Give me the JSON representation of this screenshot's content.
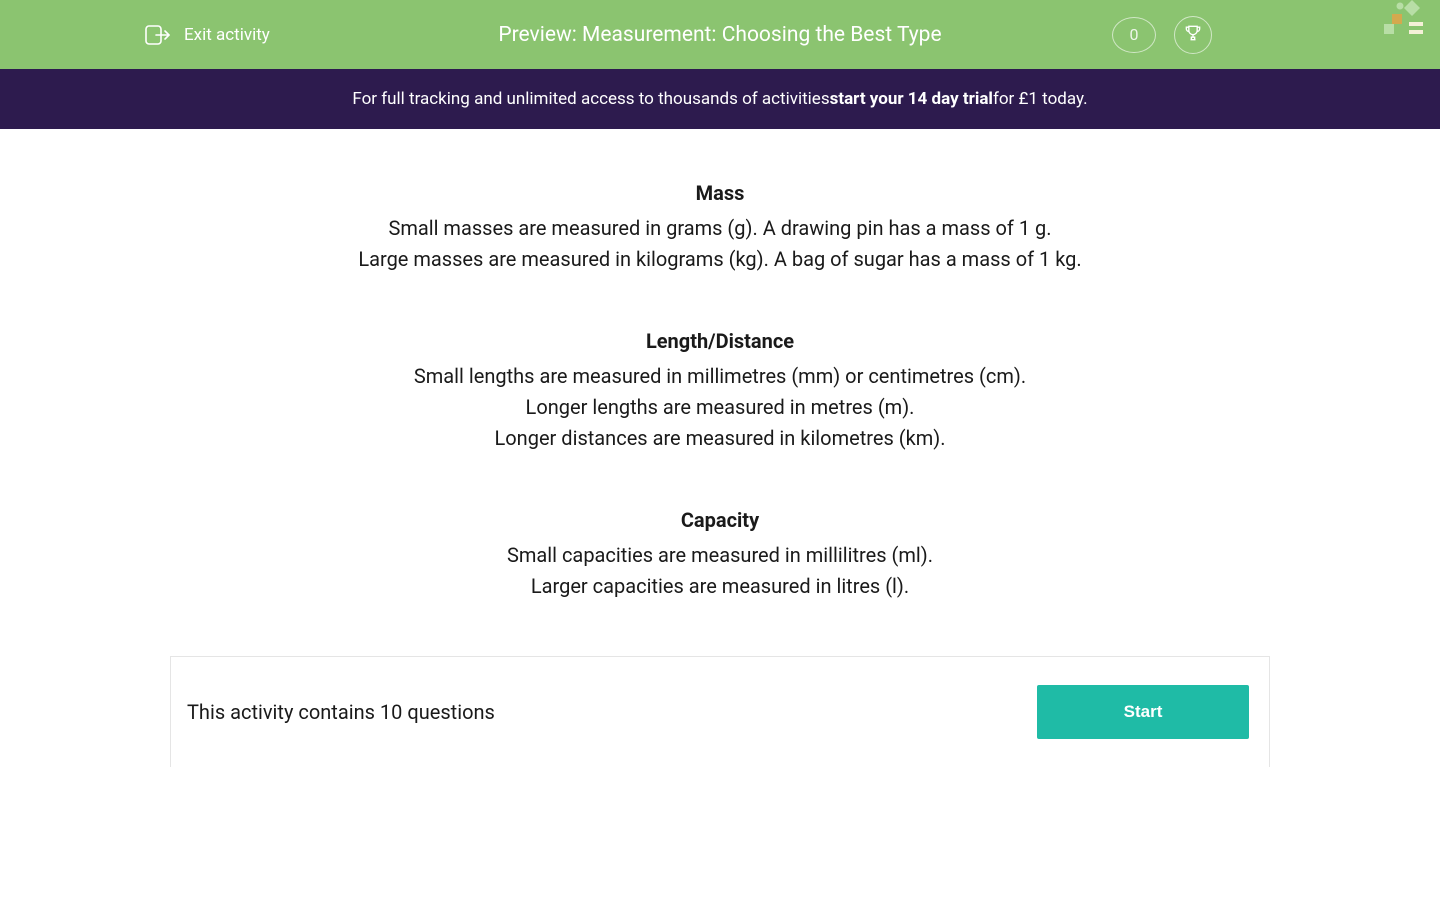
{
  "header": {
    "exit_label": "Exit activity",
    "title": "Preview: Measurement: Choosing the Best Type",
    "score": "0"
  },
  "promo": {
    "prefix": "For full tracking and unlimited access to thousands of activities ",
    "bold": "start your 14 day trial",
    "suffix": " for £1 today."
  },
  "sections": [
    {
      "title": "Mass",
      "lines": [
        "Small masses are measured in grams (g).  A drawing pin has a mass of 1 g.",
        "Large masses are measured in kilograms (kg).  A bag of sugar has a mass of 1 kg."
      ]
    },
    {
      "title": "Length/Distance",
      "lines": [
        "Small lengths are measured in millimetres (mm) or centimetres (cm).",
        "Longer lengths are measured in metres (m).",
        "Longer distances are measured in kilometres (km)."
      ]
    },
    {
      "title": "Capacity",
      "lines": [
        "Small capacities are measured in millilitres (ml).",
        "Larger capacities are measured in litres (l)."
      ]
    }
  ],
  "footer": {
    "question_count": "This activity contains 10 questions",
    "start_label": "Start"
  }
}
